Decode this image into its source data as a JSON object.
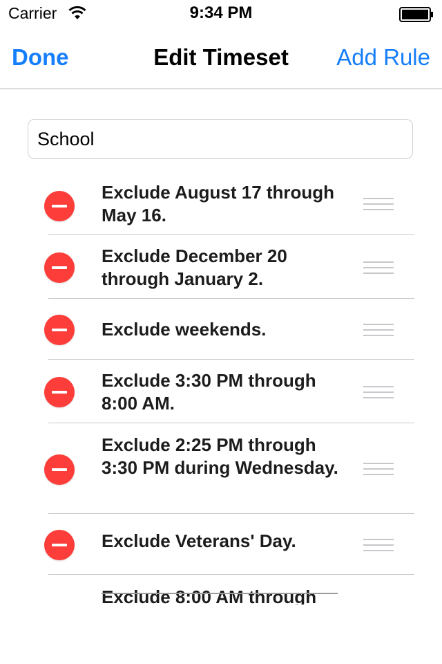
{
  "status_bar": {
    "carrier": "Carrier",
    "time": "9:34 PM"
  },
  "nav": {
    "done_label": "Done",
    "title": "Edit Timeset",
    "add_label": "Add Rule"
  },
  "timeset": {
    "name": "School"
  },
  "rules": [
    {
      "text": "Exclude August 17 through May 16."
    },
    {
      "text": "Exclude December 20 through January 2."
    },
    {
      "text": "Exclude weekends."
    },
    {
      "text": "Exclude 3:30 PM through 8:00 AM."
    },
    {
      "text": "Exclude 2:25 PM through 3:30 PM during Wednesday."
    },
    {
      "text": "Exclude Veterans' Day."
    },
    {
      "text": "Exclude 8:00 AM through"
    }
  ],
  "colors": {
    "accent": "#157efb",
    "delete": "#fc3d39",
    "separator": "#c8c7cc"
  },
  "icons": {
    "wifi": "wifi-icon",
    "battery": "battery-icon",
    "delete": "delete-circle-icon",
    "reorder": "reorder-handle-icon"
  }
}
